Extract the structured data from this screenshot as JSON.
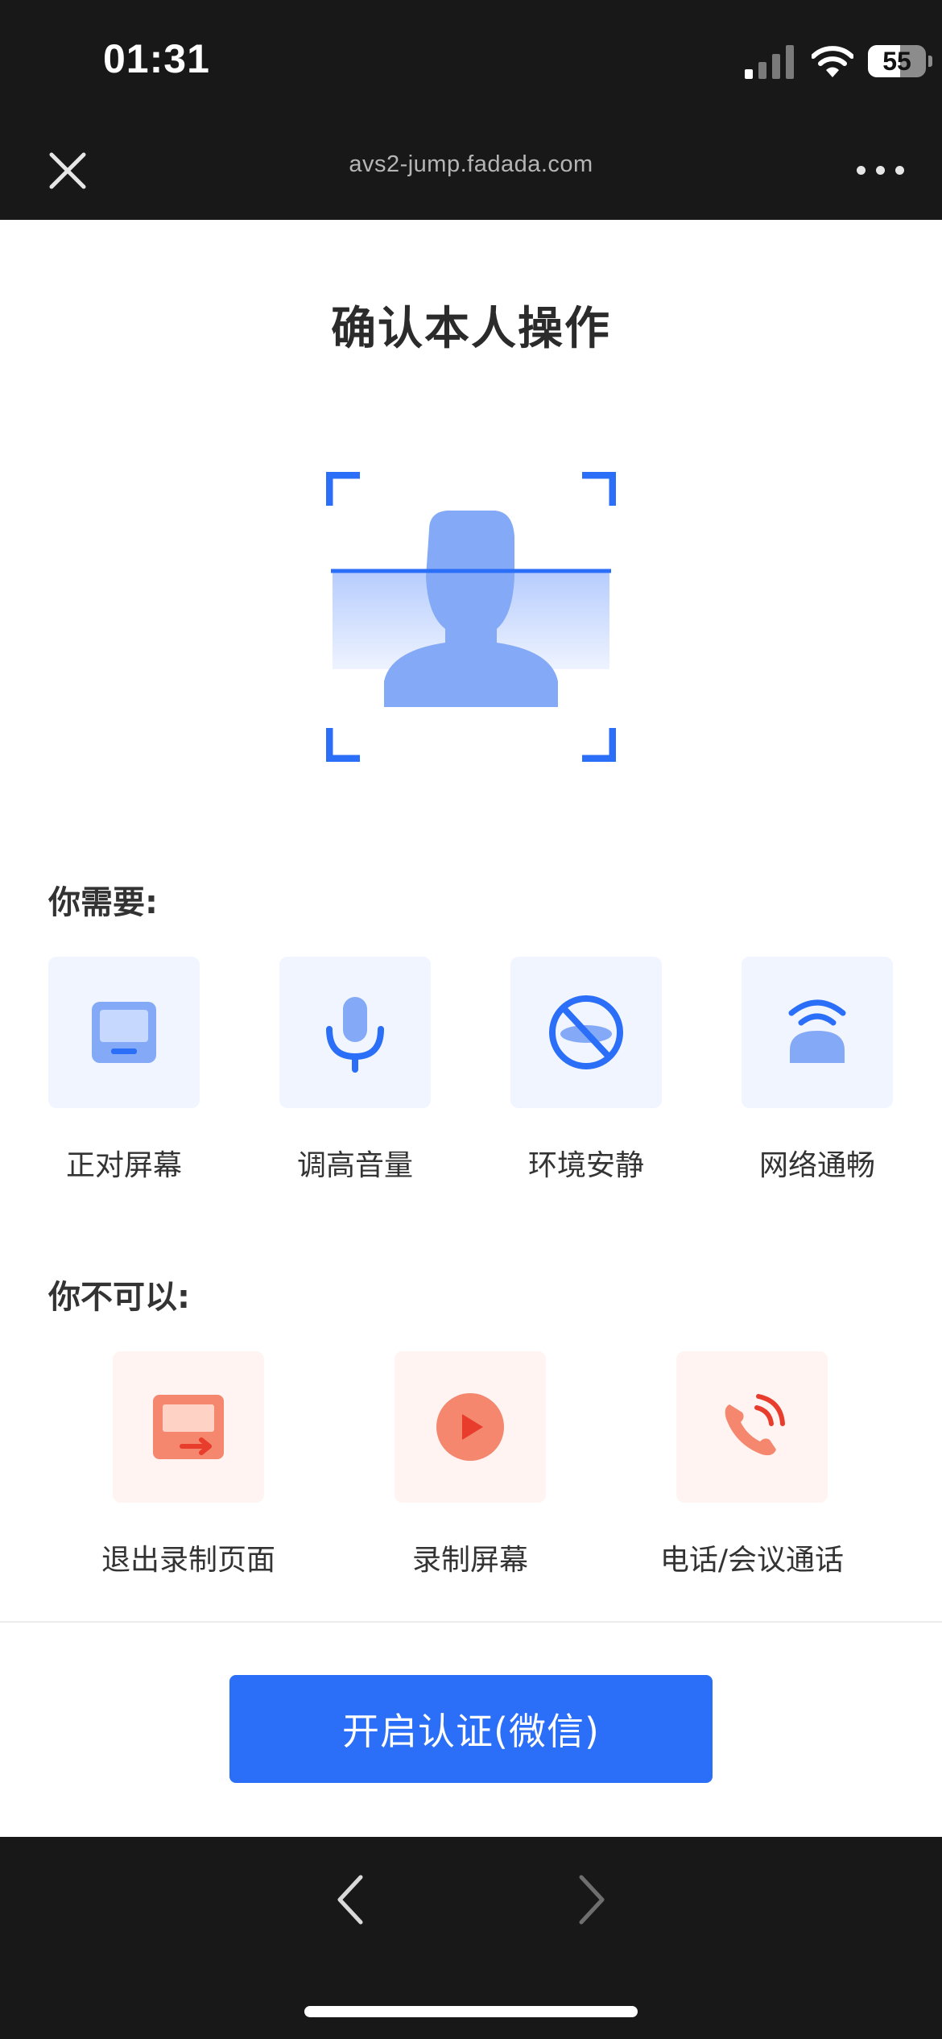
{
  "status_bar": {
    "time": "01:31",
    "battery": "55",
    "battery_level": 0.55
  },
  "browser": {
    "url": "avs2-jump.fadada.com"
  },
  "page": {
    "title": "确认本人操作",
    "need_title": "你需要:",
    "need_items": [
      {
        "label": "正对屏幕",
        "icon": "monitor-icon"
      },
      {
        "label": "调高音量",
        "icon": "microphone-icon"
      },
      {
        "label": "环境安静",
        "icon": "no-talking-icon"
      },
      {
        "label": "网络通畅",
        "icon": "person-wifi-icon"
      }
    ],
    "cannot_title": "你不可以:",
    "cannot_items": [
      {
        "label": "退出录制页面",
        "icon": "exit-screen-icon"
      },
      {
        "label": "录制屏幕",
        "icon": "record-play-icon"
      },
      {
        "label": "电话/会议通话",
        "icon": "phone-call-icon"
      }
    ]
  },
  "action": {
    "button_label": "开启认证(微信)"
  },
  "colors": {
    "accent": "#2b6ef7",
    "need_tile": "#f1f5ff",
    "cannot_tile": "#fff4f1",
    "cannot_icon": "#f4876e"
  }
}
